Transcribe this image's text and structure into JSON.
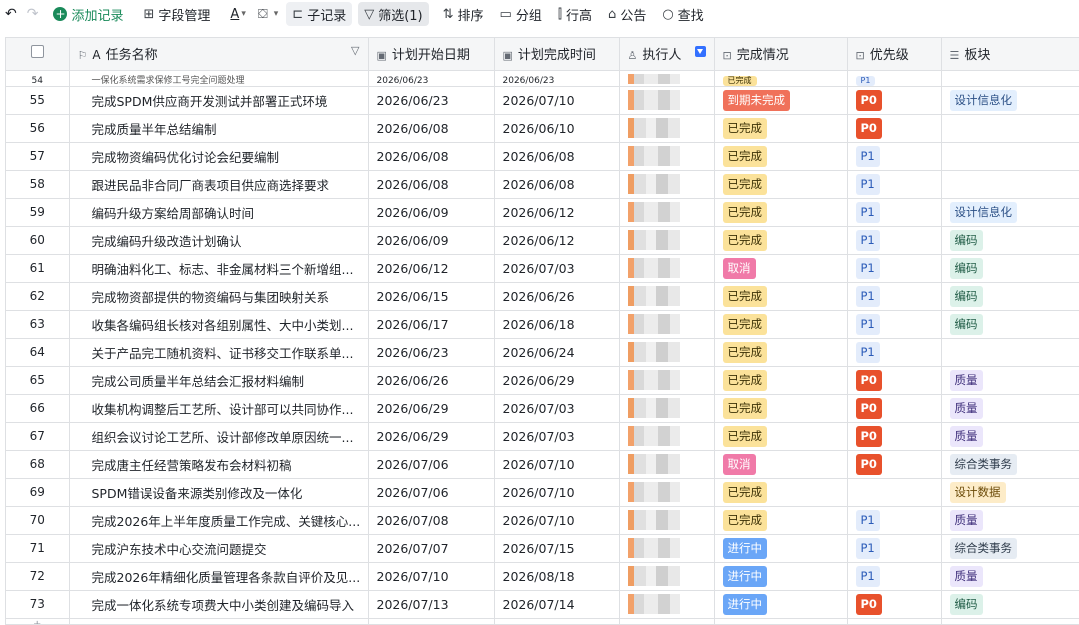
{
  "toolbar": {
    "add_record": "添加记录",
    "field_manage": "字段管理",
    "text_style": "A",
    "sub_record": "子记录",
    "filter": "筛选(1)",
    "sort": "排序",
    "group": "分组",
    "row_height": "行高",
    "notice": "公告",
    "find": "查找"
  },
  "columns": {
    "task_name": "任务名称",
    "plan_start": "计划开始日期",
    "plan_end": "计划完成时间",
    "assignee": "执行人",
    "status": "完成情况",
    "priority": "优先级",
    "block": "板块"
  },
  "colors": {
    "accent_green": "#1a8a5a",
    "status_done": "#fbe29a",
    "status_overdue": "#f0715a",
    "status_cancel": "#f07aa8",
    "status_in_progress": "#6aa6f7",
    "priority_p0": "#e8512c"
  },
  "partial_row": {
    "num": "54",
    "task": "一保化系统需求保修工号完全问题处理",
    "start": "2026/06/23",
    "end": "2026/06/23",
    "status": "已完成",
    "priority": "P1"
  },
  "rows": [
    {
      "num": "55",
      "task": "完成SPDM供应商开发测试并部署正式环境",
      "start": "2026/06/23",
      "end": "2026/07/10",
      "status": "到期未完成",
      "status_type": "over",
      "priority": "P0",
      "block": "设计信息化",
      "block_type": "info"
    },
    {
      "num": "56",
      "task": "完成质量半年总结编制",
      "start": "2026/06/08",
      "end": "2026/06/10",
      "status": "已完成",
      "status_type": "done",
      "priority": "P0",
      "block": "",
      "block_type": ""
    },
    {
      "num": "57",
      "task": "完成物资编码优化讨论会纪要编制",
      "start": "2026/06/08",
      "end": "2026/06/08",
      "status": "已完成",
      "status_type": "done",
      "priority": "P1",
      "block": "",
      "block_type": ""
    },
    {
      "num": "58",
      "task": "跟进民品非合同厂商表项目供应商选择要求",
      "start": "2026/06/08",
      "end": "2026/06/08",
      "status": "已完成",
      "status_type": "done",
      "priority": "P1",
      "block": "",
      "block_type": ""
    },
    {
      "num": "59",
      "task": "编码升级方案给周部确认时间",
      "start": "2026/06/09",
      "end": "2026/06/12",
      "status": "已完成",
      "status_type": "done",
      "priority": "P1",
      "block": "设计信息化",
      "block_type": "info"
    },
    {
      "num": "60",
      "task": "完成编码升级改造计划确认",
      "start": "2026/06/09",
      "end": "2026/06/12",
      "status": "已完成",
      "status_type": "done",
      "priority": "P1",
      "block": "编码",
      "block_type": "code"
    },
    {
      "num": "61",
      "task": "明确油料化工、标志、非金属材料三个新增组...",
      "start": "2026/06/12",
      "end": "2026/07/03",
      "status": "取消",
      "status_type": "cancel",
      "priority": "P1",
      "block": "编码",
      "block_type": "code"
    },
    {
      "num": "62",
      "task": "完成物资部提供的物资编码与集团映射关系",
      "start": "2026/06/15",
      "end": "2026/06/26",
      "status": "已完成",
      "status_type": "done",
      "priority": "P1",
      "block": "编码",
      "block_type": "code"
    },
    {
      "num": "63",
      "task": "收集各编码组长核对各组别属性、大中小类划...",
      "start": "2026/06/17",
      "end": "2026/06/18",
      "status": "已完成",
      "status_type": "done",
      "priority": "P1",
      "block": "编码",
      "block_type": "code"
    },
    {
      "num": "64",
      "task": "关于产品完工随机资料、证书移交工作联系单...",
      "start": "2026/06/23",
      "end": "2026/06/24",
      "status": "已完成",
      "status_type": "done",
      "priority": "P1",
      "block": "",
      "block_type": ""
    },
    {
      "num": "65",
      "task": "完成公司质量半年总结会汇报材料编制",
      "start": "2026/06/26",
      "end": "2026/06/29",
      "status": "已完成",
      "status_type": "done",
      "priority": "P0",
      "block": "质量",
      "block_type": "quality"
    },
    {
      "num": "66",
      "task": "收集机构调整后工艺所、设计部可以共同协作...",
      "start": "2026/06/29",
      "end": "2026/07/03",
      "status": "已完成",
      "status_type": "done",
      "priority": "P0",
      "block": "质量",
      "block_type": "quality"
    },
    {
      "num": "67",
      "task": "组织会议讨论工艺所、设计部修改单原因统一...",
      "start": "2026/06/29",
      "end": "2026/07/03",
      "status": "已完成",
      "status_type": "done",
      "priority": "P0",
      "block": "质量",
      "block_type": "quality"
    },
    {
      "num": "68",
      "task": "完成唐主任经营策略发布会材料初稿",
      "start": "2026/07/06",
      "end": "2026/07/10",
      "status": "取消",
      "status_type": "cancel",
      "priority": "P0",
      "block": "综合类事务",
      "block_type": "misc"
    },
    {
      "num": "69",
      "task": "SPDM错误设备来源类别修改及一体化",
      "start": "2026/07/06",
      "end": "2026/07/10",
      "status": "已完成",
      "status_type": "done",
      "priority": "",
      "block": "设计数据",
      "block_type": "data"
    },
    {
      "num": "70",
      "task": "完成2026年上半年度质量工作完成、关键核心...",
      "start": "2026/07/08",
      "end": "2026/07/10",
      "status": "已完成",
      "status_type": "done",
      "priority": "P1",
      "block": "质量",
      "block_type": "quality"
    },
    {
      "num": "71",
      "task": "完成沪东技术中心交流问题提交",
      "start": "2026/07/07",
      "end": "2026/07/15",
      "status": "进行中",
      "status_type": "doing",
      "priority": "P1",
      "block": "综合类事务",
      "block_type": "misc"
    },
    {
      "num": "72",
      "task": "完成2026年精细化质量管理各条款自评价及见...",
      "start": "2026/07/10",
      "end": "2026/08/18",
      "status": "进行中",
      "status_type": "doing",
      "priority": "P1",
      "block": "质量",
      "block_type": "quality"
    },
    {
      "num": "73",
      "task": "完成一体化系统专项费大中小类创建及编码导入",
      "start": "2026/07/13",
      "end": "2026/07/14",
      "status": "进行中",
      "status_type": "doing",
      "priority": "P0",
      "block": "编码",
      "block_type": "code"
    }
  ]
}
